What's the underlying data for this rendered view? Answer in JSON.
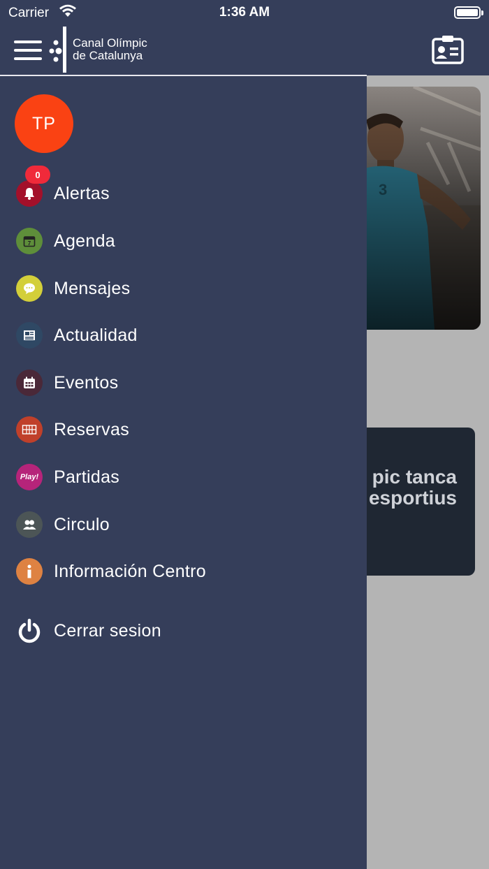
{
  "status_bar": {
    "carrier": "Carrier",
    "time": "1:36 AM"
  },
  "header": {
    "logo_line1": "Canal Olímpic",
    "logo_line2": "de Catalunya",
    "menu_icon": "hamburger-icon",
    "profile_icon": "id-card-icon"
  },
  "drawer": {
    "avatar_initials": "TP",
    "items": [
      {
        "label": "Alertas",
        "icon": "bell-icon",
        "color": "#a3102a",
        "badge": "0"
      },
      {
        "label": "Agenda",
        "icon": "calendar-icon",
        "color": "#5e8e3a"
      },
      {
        "label": "Mensajes",
        "icon": "chat-bubble-icon",
        "color": "#d3cf3a"
      },
      {
        "label": "Actualidad",
        "icon": "newspaper-icon",
        "color": "#2f4864"
      },
      {
        "label": "Eventos",
        "icon": "calendar-grid-icon",
        "color": "#4a2838"
      },
      {
        "label": "Reservas",
        "icon": "court-grid-icon",
        "color": "#c0402a"
      },
      {
        "label": "Partidas",
        "icon": "play-icon",
        "color": "#b6247a",
        "icon_text": "Play!"
      },
      {
        "label": "Circulo",
        "icon": "people-icon",
        "color": "#4c5556"
      },
      {
        "label": "Información Centro",
        "icon": "info-icon",
        "color": "#de8242"
      }
    ],
    "logout": {
      "label": "Cerrar sesion",
      "icon": "power-icon"
    }
  },
  "background": {
    "news_title_line1": "pic tanca",
    "news_title_line2": "esportius"
  },
  "colors": {
    "header_bg": "#353e5a",
    "drawer_bg": "#353e5a",
    "avatar_bg": "#fa4213",
    "badge_bg": "#f02a3a",
    "overlay_bg": "#b4b4b4"
  }
}
